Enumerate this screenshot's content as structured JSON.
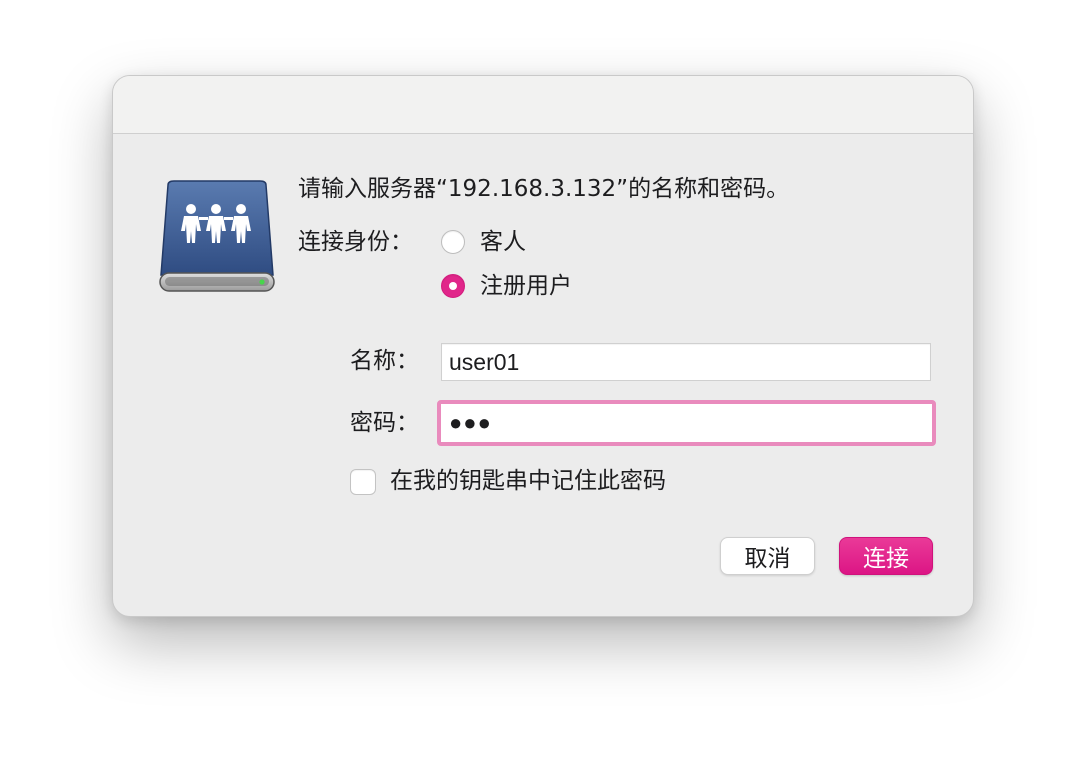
{
  "dialog": {
    "message": "请输入服务器“192.168.3.132”的名称和密码。",
    "connect_as": {
      "label": "连接身份：",
      "options": [
        {
          "label": "客人",
          "selected": false
        },
        {
          "label": "注册用户",
          "selected": true
        }
      ]
    },
    "name": {
      "label": "名称：",
      "value": "user01"
    },
    "password": {
      "label": "密码：",
      "masked_value": "●●●"
    },
    "remember": {
      "label": "在我的钥匙串中记住此密码",
      "checked": false
    },
    "buttons": {
      "cancel": "取消",
      "connect": "连接"
    },
    "icon": "network-server-icon"
  },
  "colors": {
    "accent": "#e1268a",
    "focus_ring": "#e98bbd",
    "dialog_background": "#ececec"
  }
}
